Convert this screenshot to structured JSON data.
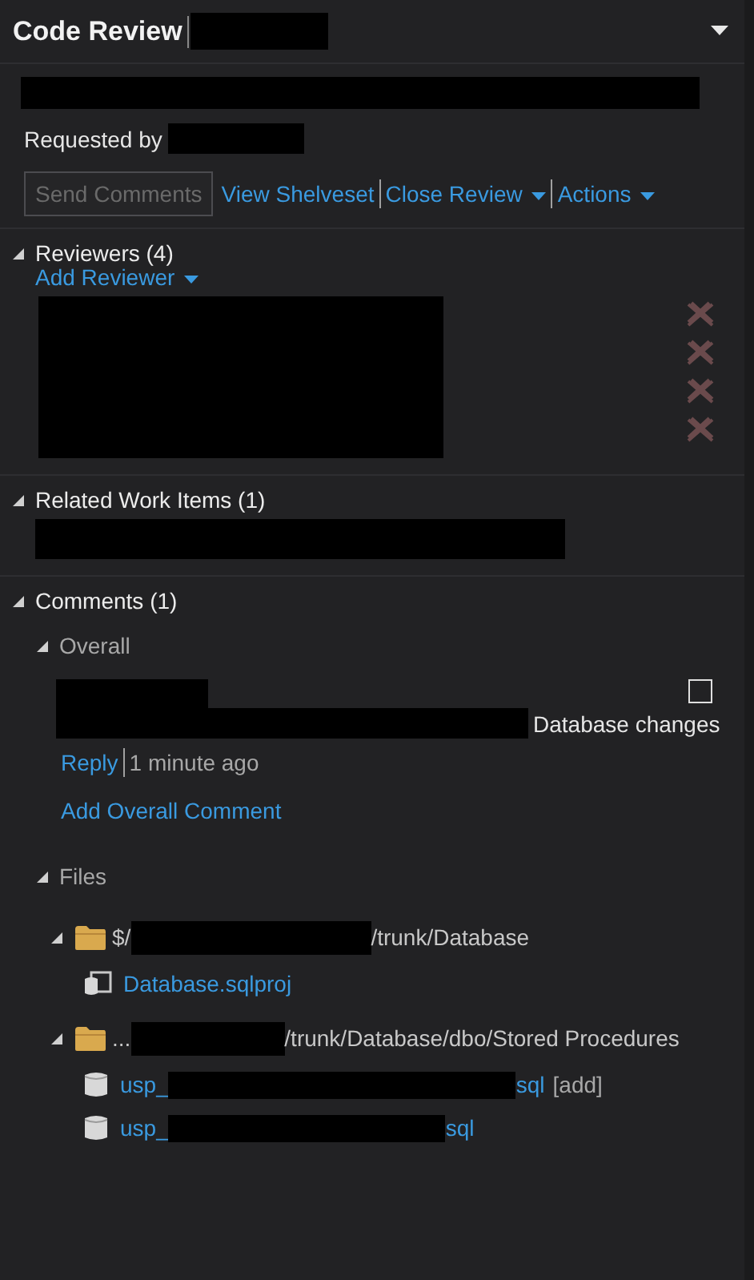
{
  "panel": {
    "title": "Code Review",
    "requested_by_label": "Requested by"
  },
  "actions": [
    {
      "kind": "button",
      "label": "Send Comments",
      "disabled": true
    },
    {
      "kind": "link",
      "label": "View Shelveset",
      "disabled": false,
      "dropdown": false
    },
    {
      "kind": "link",
      "label": "Close Review",
      "disabled": false,
      "dropdown": true
    },
    {
      "kind": "link",
      "label": "Actions",
      "disabled": false,
      "dropdown": true
    }
  ],
  "sections": [
    {
      "kind": "reviewers",
      "title": "Reviewers (4)",
      "expanded": true,
      "add_link": "Add Reviewer",
      "reviewers": [
        {
          "remove_enabled": false
        },
        {
          "remove_enabled": false
        },
        {
          "remove_enabled": false
        },
        {
          "remove_enabled": false
        }
      ]
    },
    {
      "kind": "work_items",
      "title": "Related Work Items (1)",
      "expanded": true
    },
    {
      "kind": "comments",
      "title": "Comments (1)",
      "expanded": true,
      "groups": [
        {
          "kind": "overall",
          "title": "Overall",
          "expanded": true,
          "comments": [
            {
              "text_end": "Database changes",
              "resolved": false,
              "reply_link": "Reply",
              "time": "1 minute ago"
            }
          ],
          "add_link": "Add Overall Comment"
        },
        {
          "kind": "files",
          "title": "Files",
          "expanded": true,
          "folders": [
            {
              "path_start": "$/",
              "path_end": "/trunk/Database",
              "expanded": true,
              "files": [
                {
                  "kind": "project",
                  "name": "Database.sqlproj"
                }
              ]
            },
            {
              "path_start": "...",
              "path_end": "/trunk/Database/dbo/Stored Procedures",
              "expanded": true,
              "files": [
                {
                  "kind": "sql",
                  "name_start": "usp_",
                  "name_end": "sql",
                  "status": "[add]"
                },
                {
                  "kind": "sql",
                  "name_start": "usp_",
                  "name_end": "sql"
                }
              ]
            }
          ]
        }
      ]
    }
  ]
}
